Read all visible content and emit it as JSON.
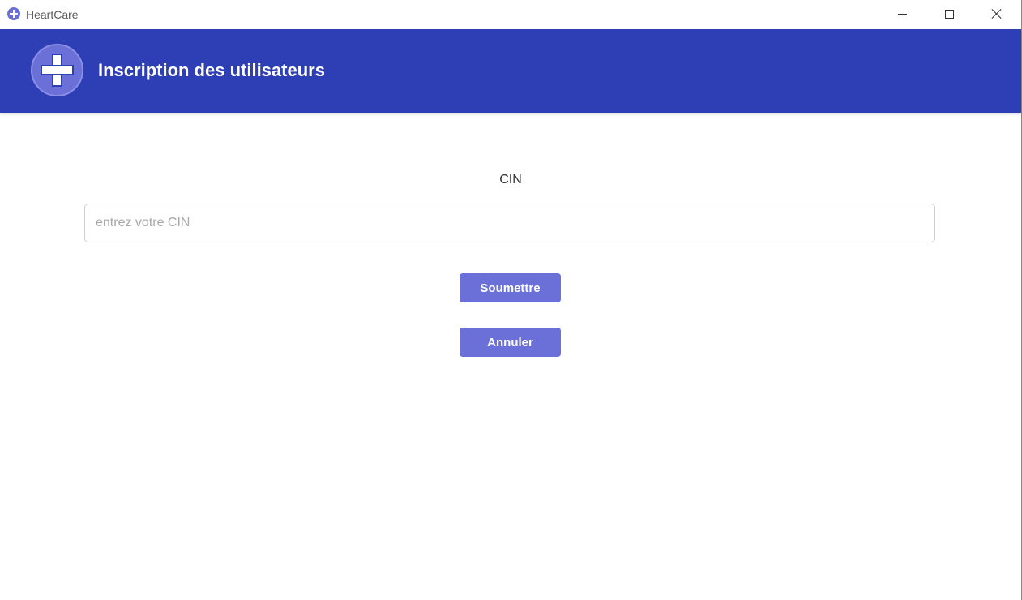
{
  "window": {
    "app_title": "HeartCare",
    "app_icon": "plus-circle-icon",
    "controls": {
      "minimize": "minimize-icon",
      "maximize": "maximize-icon",
      "close": "close-icon"
    }
  },
  "header": {
    "title": "Inscription des utilisateurs",
    "logo_icon": "medical-cross-icon",
    "background": "#2e3fb5"
  },
  "form": {
    "cin_label": "CIN",
    "cin_input": {
      "value": "",
      "placeholder": "entrez votre CIN"
    },
    "submit_label": "Soumettre",
    "cancel_label": "Annuler",
    "button_color": "#6b70d8"
  }
}
